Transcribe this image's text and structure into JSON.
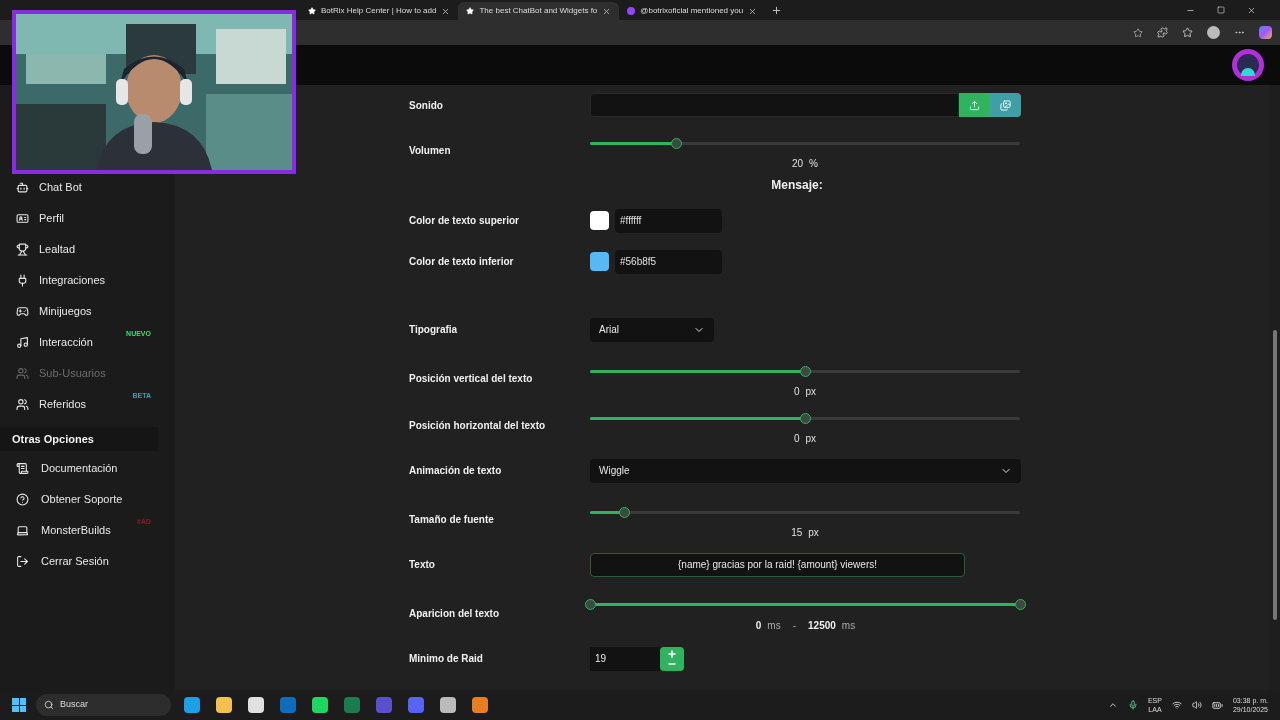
{
  "browser": {
    "tabs": [
      {
        "title": "BotRix Help Center | How to add",
        "selected": false,
        "kind": "page"
      },
      {
        "title": "The best ChatBot and Widgets fo",
        "selected": true,
        "kind": "page"
      },
      {
        "title": "@botrixoficial mentioned you",
        "selected": false,
        "kind": "twitch"
      }
    ]
  },
  "sidebar": {
    "items": [
      {
        "label": "Chat Bot",
        "disabled": false
      },
      {
        "label": "Perfil",
        "disabled": false
      },
      {
        "label": "Lealtad",
        "disabled": false
      },
      {
        "label": "Integraciones",
        "disabled": false
      },
      {
        "label": "Minijuegos",
        "disabled": false
      },
      {
        "label": "Interacción",
        "disabled": false,
        "badge": "NUEVO",
        "color": "#2ee66b"
      },
      {
        "label": "Sub-Usuarios",
        "disabled": true
      },
      {
        "label": "Referidos",
        "disabled": false,
        "badge": "BETA",
        "color": "#2fa3b5"
      }
    ],
    "section_title": "Otras Opciones",
    "other_items": [
      {
        "label": "Documentación",
        "disabled": false
      },
      {
        "label": "Obtener Soporte",
        "disabled": false
      },
      {
        "label": "MonsterBuilds",
        "disabled": false,
        "badge": "#AD",
        "color": "#8a1c2c"
      },
      {
        "label": "Cerrar Sesión",
        "disabled": false
      }
    ]
  },
  "form": {
    "top_rows": [
      {
        "kind": "file",
        "label": "Sonido"
      },
      {
        "kind": "slider",
        "label": "Volumen",
        "level": 0.2,
        "reading": "20",
        "unit": "%"
      }
    ],
    "heading": "Mensaje:",
    "color_rows": [
      {
        "kind": "color",
        "label": "Color de texto superior",
        "value": "#ffffff",
        "color": "#ffffff"
      },
      {
        "kind": "color",
        "label": "Color de texto inferior",
        "value": "#56b8f5",
        "color": "#56b8f5"
      }
    ],
    "style_rows": [
      {
        "kind": "select",
        "label": "Tipografia",
        "value": "Arial",
        "wide": false
      },
      {
        "kind": "slider",
        "label": "Posición vertical del texto",
        "level": 0.5,
        "reading": "0",
        "unit": "px"
      },
      {
        "kind": "slider",
        "label": "Posición horizontal del texto",
        "level": 0.5,
        "reading": "0",
        "unit": "px"
      },
      {
        "kind": "select",
        "label": "Animación de texto",
        "value": "Wiggle",
        "wide": true
      },
      {
        "kind": "slider",
        "label": "Tamaño de fuente",
        "level": 0.08,
        "reading": "15",
        "unit": "px"
      },
      {
        "kind": "text",
        "label": "Texto",
        "value": "{name} gracias por la raid! {amount} viewers!"
      },
      {
        "kind": "range",
        "label": "Aparicion del texto",
        "low": {
          "level": 0,
          "reading": "0",
          "unit": "ms"
        },
        "separator": "-",
        "high": {
          "level": 1,
          "reading": "12500",
          "unit": "ms"
        }
      },
      {
        "kind": "number",
        "label": "Minimo de Raid",
        "value": "19"
      }
    ]
  },
  "taskbar": {
    "search_placeholder": "Buscar",
    "language": "ESP",
    "layout": "LAA",
    "time": "03:38 p. m.",
    "date": "29/10/2025"
  }
}
